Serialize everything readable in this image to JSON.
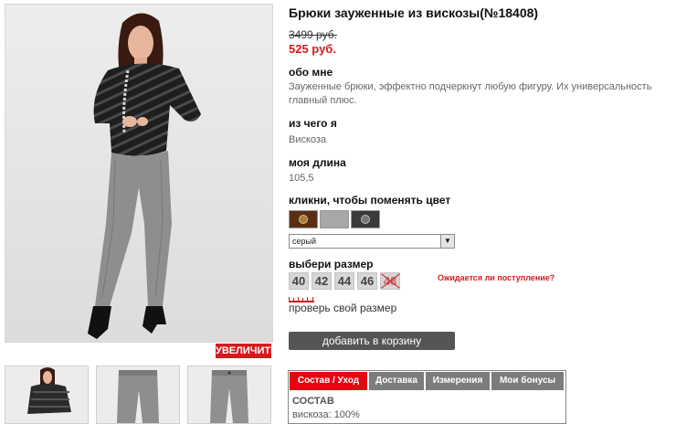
{
  "product": {
    "title": "Брюки зауженные из вискозы(№18408)",
    "old_price": "3499 руб.",
    "new_price": "525 руб."
  },
  "gallery": {
    "zoom_label": "УВЕЛИЧИТЬ"
  },
  "sections": {
    "about": {
      "heading": "обо мне",
      "text": "Зауженные брюки, эффектно подчеркнут любую фигуру. Их универсальность главный плюс."
    },
    "material": {
      "heading": "из чего я",
      "text": "Вискоза"
    },
    "length": {
      "heading": "моя длина",
      "text": "105,5"
    },
    "color": {
      "heading": "кликни, чтобы поменять цвет",
      "selected": "серый"
    },
    "size": {
      "heading": "выбери размер",
      "notify_label": "Ожидается ли поступление?",
      "check_label": "проверь свой размер"
    }
  },
  "swatches": [
    {
      "name": "brown",
      "color": "#5a2e14"
    },
    {
      "name": "grey",
      "color": "#a8a6a8"
    },
    {
      "name": "dark",
      "color": "#3a3a3a"
    }
  ],
  "sizes": [
    {
      "label": "40",
      "available": true
    },
    {
      "label": "42",
      "available": true
    },
    {
      "label": "44",
      "available": true
    },
    {
      "label": "46",
      "available": true
    },
    {
      "label": "48",
      "available": false
    }
  ],
  "cart": {
    "label": "добавить в корзину"
  },
  "tabs": {
    "items": [
      {
        "label": "Состав / Уход",
        "active": true
      },
      {
        "label": "Доставка",
        "active": false
      },
      {
        "label": "Измерения",
        "active": false
      },
      {
        "label": "Мои бонусы",
        "active": false
      }
    ],
    "content_heading": "СОСТАВ",
    "content_text": "вискоза: 100%"
  },
  "colors": {
    "accent": "#d21b1b",
    "tab_active": "#e30613",
    "tab_inactive": "#7c7c7c",
    "cart_button": "#555555"
  }
}
